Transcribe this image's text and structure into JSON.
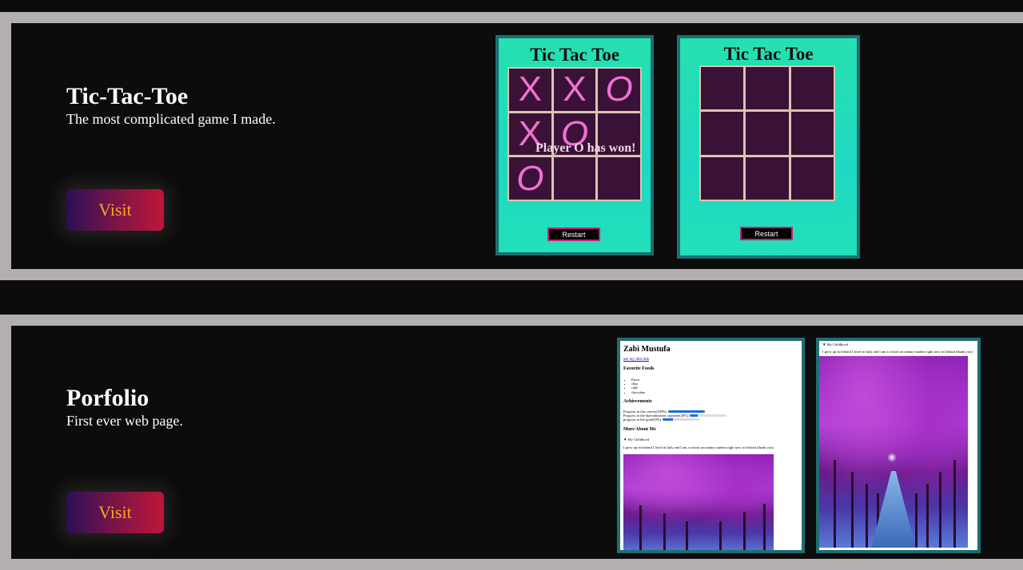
{
  "projects": [
    {
      "title": "Tic-Tac-Toe",
      "description": "The most complicated game I made.",
      "visit_label": "Visit",
      "shots": [
        {
          "game_title": "Tic Tac Toe",
          "cells": [
            "X",
            "X",
            "O",
            "X",
            "O",
            "",
            "O",
            "",
            ""
          ],
          "message": "Player O has won!",
          "restart_label": "Restart"
        },
        {
          "game_title": "Tic Tac Toe",
          "cells": [
            "",
            "",
            "",
            "",
            "",
            "",
            "",
            "",
            ""
          ],
          "message": "",
          "restart_label": "Restart"
        }
      ]
    },
    {
      "title": "Porfolio",
      "description": "First ever web page.",
      "visit_label": "Visit",
      "portfolio": {
        "name": "Zabi Mustufa",
        "link_text": "see my ibm link",
        "favorite_foods_heading": "Favorite Foods",
        "foods": [
          "Pizza",
          "chip",
          "cake",
          "chocolate"
        ],
        "achievements_heading": "Achievements",
        "progress": [
          {
            "label": "Progress in this course(100%)",
            "value": 1.0
          },
          {
            "label": "Progress in the Specialization capstone(20%)",
            "value": 0.2
          },
          {
            "label": "progress in life goal(29%)",
            "value": 0.29
          }
        ],
        "more_heading": "More About Me",
        "details_summary": "▼ My Childhood",
        "childhood_text": "I grew up in Ireland I lived in Italy and I am a school secondary student right now in Ireland (thank you)"
      }
    }
  ]
}
